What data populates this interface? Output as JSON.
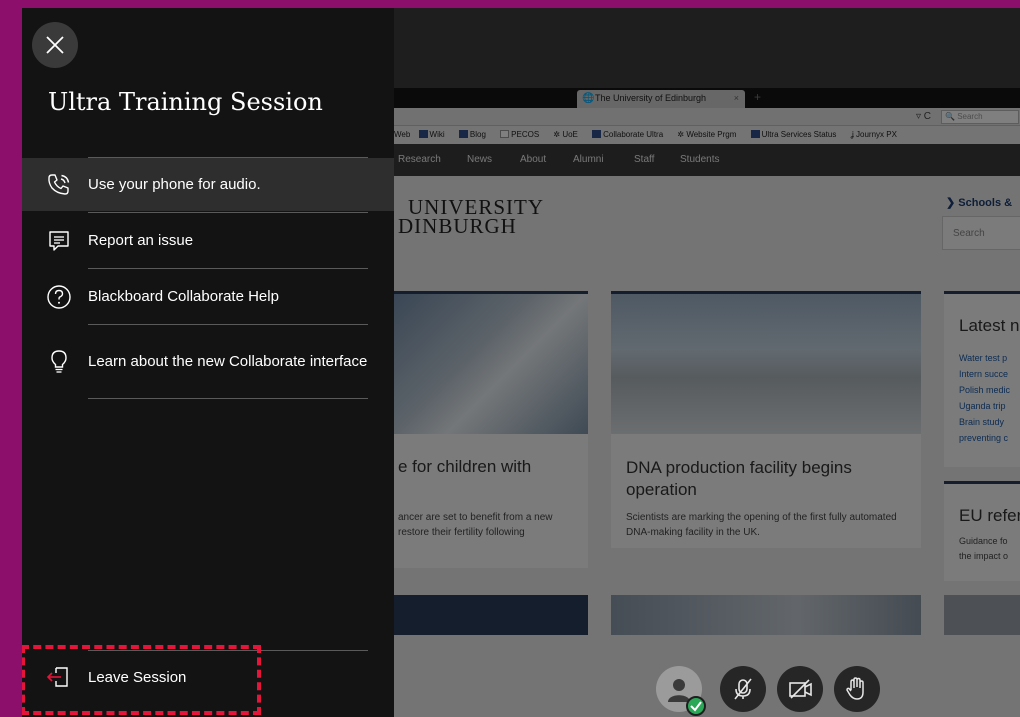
{
  "panel": {
    "title": "Ultra Training Session",
    "items": [
      {
        "label": "Use your phone for audio.",
        "icon": "phone-icon"
      },
      {
        "label": "Report an issue",
        "icon": "comment-icon"
      },
      {
        "label": "Blackboard Collaborate Help",
        "icon": "help-icon"
      },
      {
        "label": "Learn about the new Collaborate interface",
        "icon": "lightbulb-icon"
      }
    ],
    "leave_label": "Leave Session",
    "close_icon": "close-icon"
  },
  "shared_screen": {
    "tab_title": "The University of Edinburgh",
    "search_placeholder": "Search",
    "bookmarks": [
      "Web",
      "Wiki",
      "Blog",
      "PECOS",
      "UoE",
      "Collaborate Ultra",
      "Website Prgm",
      "Ultra Services Status",
      "Journyx PX"
    ],
    "nav": [
      "Research",
      "News",
      "About",
      "Alumni",
      "Staff",
      "Students"
    ],
    "logo_line1": "UNIVERSITY",
    "logo_line2": "DINBURGH",
    "schools_link": "Schools &",
    "site_search": "Search",
    "card1": {
      "title": "e for children with",
      "text": "ancer are set to benefit from a new\nrestore their fertility following"
    },
    "card2": {
      "title": "DNA production facility begins operation",
      "text": "Scientists are marking the opening of the first fully automated DNA-making facility in the UK."
    },
    "latest": {
      "title": "Latest n",
      "items": [
        "Water test p",
        "Intern succe",
        "Polish medic",
        "Uganda trip",
        "Brain study",
        "preventing c"
      ]
    },
    "eu": {
      "title": "EU refer",
      "text": "Guidance fo\nthe impact o"
    }
  },
  "controls": {
    "status": "connected",
    "buttons": [
      "avatar-icon",
      "mic-muted-icon",
      "camera-off-icon",
      "raise-hand-icon"
    ]
  },
  "colors": {
    "border": "#8d0f6c",
    "panel_bg": "#131313",
    "highlight": "#e5143a",
    "status_ok": "#2aa857"
  }
}
